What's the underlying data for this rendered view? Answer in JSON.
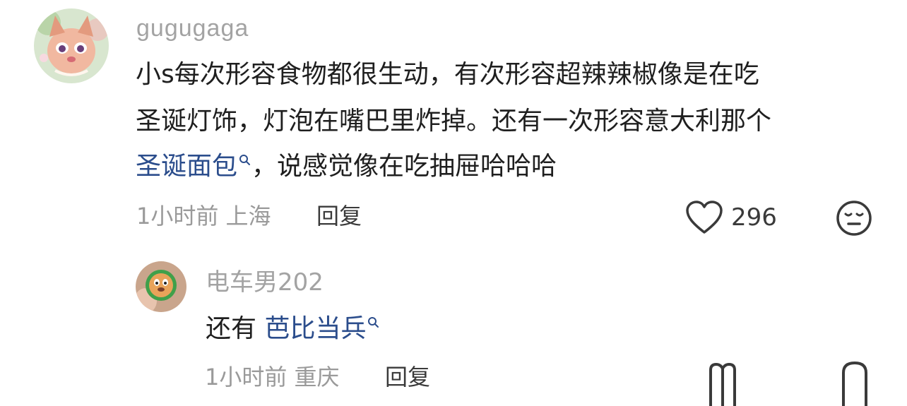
{
  "comment": {
    "username": "gugugaga",
    "lines": [
      "小s每次形容食物都很生动，有次形容超辣辣椒像是在吃",
      "圣诞灯饰，灯泡在嘴巴里炸掉。还有一次形容意大利那个"
    ],
    "line3_link": "圣诞面包",
    "line3_rest": "，说感觉像在吃抽屉哈哈哈",
    "time": "1小时前",
    "location": "上海",
    "reply_label": "回复",
    "like_count": "296",
    "like_icon": "heart-outline-icon",
    "dislike_icon": "unhappy-face-icon"
  },
  "reply": {
    "username": "电车男202",
    "text_prefix": "还有 ",
    "link": "芭比当兵",
    "time": "1小时前",
    "location": "重庆",
    "reply_label": "回复"
  },
  "colors": {
    "link": "#2b4d8c",
    "meta": "#9a9a9a",
    "username": "#a3a3a3",
    "text": "#1f1f1f"
  }
}
